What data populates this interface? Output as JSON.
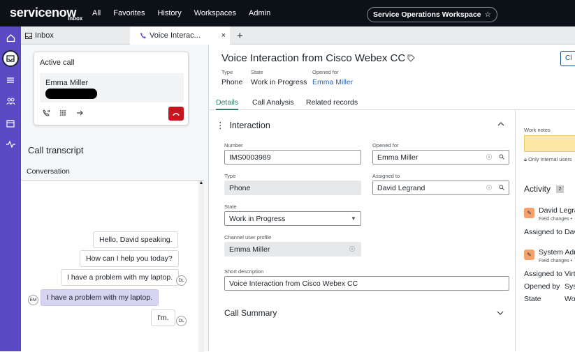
{
  "topnav": {
    "logo": "servicenow",
    "logo_sub": "Inbox",
    "links": [
      "All",
      "Favorites",
      "History",
      "Workspaces",
      "Admin"
    ],
    "workspace_button": "Service Operations Workspace",
    "star_icon": "☆"
  },
  "rail": {
    "icons": [
      "home-icon",
      "inbox-icon",
      "list-icon",
      "team-icon",
      "calendar-icon",
      "pulse-icon"
    ]
  },
  "tabs": {
    "inbox": "Inbox",
    "voice": "Voice Interac...",
    "close": "×",
    "add": "+"
  },
  "active_call": {
    "title": "Active call",
    "caller": "Emma Miller"
  },
  "transcript": {
    "title": "Call transcript",
    "conversation_label": "Conversation",
    "messages": [
      {
        "text": "Hello, David speaking.",
        "speaker": ""
      },
      {
        "text": "How can I help you today?",
        "speaker": ""
      },
      {
        "text": "I have a problem with my laptop.",
        "speaker": "DL"
      },
      {
        "text": "I have a problem with my laptop.",
        "speaker": "EM"
      },
      {
        "text": "I'm.",
        "speaker": "DL"
      }
    ]
  },
  "record": {
    "title": "Voice Interaction from Cisco Webex CC",
    "header_button": "Cl",
    "meta": [
      {
        "label": "Type",
        "value": "Phone"
      },
      {
        "label": "State",
        "value": "Work in Progress"
      },
      {
        "label": "Opened for",
        "value": "Emma Miller"
      }
    ],
    "subtabs": [
      "Details",
      "Call Analysis",
      "Related records"
    ]
  },
  "form": {
    "section_title": "Interaction",
    "fields": {
      "number": {
        "label": "Number",
        "value": "IMS0003989"
      },
      "opened_for": {
        "label": "Opened for",
        "value": "Emma Miller"
      },
      "type": {
        "label": "Type",
        "value": "Phone"
      },
      "assigned_to": {
        "label": "Assigned to",
        "value": "David Legrand"
      },
      "state": {
        "label": "State",
        "value": "Work in Progress"
      },
      "channel_user_profile": {
        "label": "Channel user profile",
        "value": "Emma Miller"
      },
      "short_description": {
        "label": "Short description",
        "value": "Voice Interaction from Cisco Webex CC"
      }
    },
    "call_summary": "Call Summary"
  },
  "side_panel": {
    "work_notes_label": "Work notes",
    "internal_note": "Only internal users",
    "activity_title": "Activity",
    "activity_count": "2",
    "entries": [
      {
        "name": "David Legra",
        "sub": "Field changes •"
      },
      {
        "name": "System Adm",
        "sub": "Field changes •"
      }
    ],
    "details": [
      {
        "key": "Assigned to",
        "value": "Dav"
      },
      {
        "key": "Assigned to",
        "value": "Virt"
      },
      {
        "key": "Opened by",
        "value": "Sys"
      },
      {
        "key": "State",
        "value": "Wo"
      }
    ]
  },
  "colors": {
    "rail": "#5a4bc4",
    "topnav": "#0c1118",
    "accent_green": "#2c7a63",
    "end_call": "#c4161c",
    "link": "#2d66b3"
  }
}
